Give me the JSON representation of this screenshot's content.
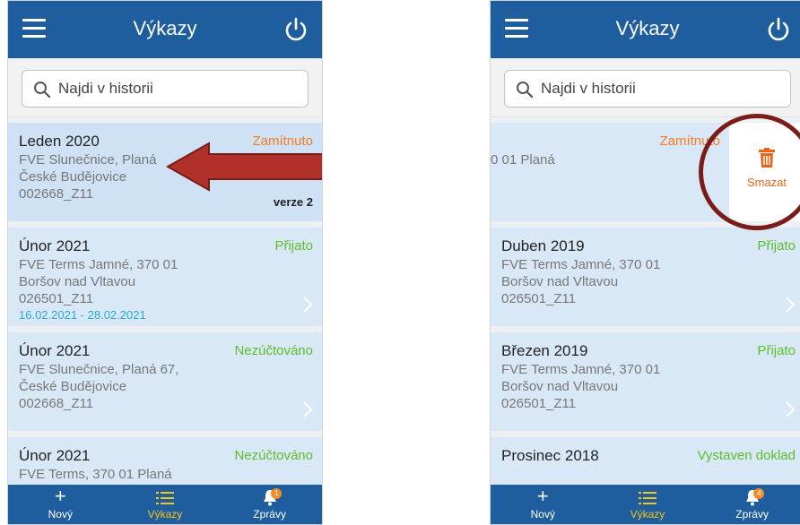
{
  "colors": {
    "appbar": "#1f5e9e",
    "status_rejected": "#f57c20",
    "status_accepted": "#5cbf2a",
    "active_tab": "#f5c518",
    "dates": "#2aa8d8",
    "annotation": "#b0312a"
  },
  "header": {
    "title": "Výkazy",
    "menu_icon": "hamburger-icon",
    "power_icon": "power-icon"
  },
  "search": {
    "placeholder": "Najdi v historii",
    "icon": "search-icon"
  },
  "left": {
    "items": [
      {
        "period": "Leden 2020",
        "line1": "FVE Slunečnice, Planá",
        "line2": "České Budějovice",
        "line3": "002668_Z11",
        "status": "Zamítnuto",
        "version": "verze 2"
      },
      {
        "period": "Únor 2021",
        "line1": "FVE Terms Jamné, 370 01",
        "line2": "Boršov nad Vltavou",
        "line3": "026501_Z11",
        "dates": "16.02.2021 - 28.02.2021",
        "status": "Přijato"
      },
      {
        "period": "Únor 2021",
        "line1": "FVE Slunečnice, Planá 67,",
        "line2": "České Budějovice",
        "line3": "002668_Z11",
        "status": "Nezúčtováno"
      },
      {
        "period": "Únor 2021",
        "line1": "FVE Terms, 370 01 Planá",
        "line2": "",
        "line3": "",
        "status": "Nezúčtováno"
      }
    ]
  },
  "right": {
    "swiped": {
      "line1": "0 01 Planá",
      "status": "Zamítnuto",
      "delete_label": "Smazat",
      "delete_icon": "trash-icon"
    },
    "items": [
      {
        "period": "Duben 2019",
        "line1": "FVE Terms Jamné, 370 01",
        "line2": "Boršov nad Vltavou",
        "line3": "026501_Z11",
        "status": "Přijato"
      },
      {
        "period": "Březen 2019",
        "line1": "FVE Terms Jamné, 370 01",
        "line2": "Boršov nad Vltavou",
        "line3": "026501_Z11",
        "status": "Přijato"
      },
      {
        "period": "Prosinec 2018",
        "line1": "",
        "line2": "",
        "line3": "",
        "status": "Vystaven doklad"
      }
    ]
  },
  "tabs": [
    {
      "label": "Nový",
      "icon": "plus-icon"
    },
    {
      "label": "Výkazy",
      "icon": "list-icon"
    },
    {
      "label": "Zprávy",
      "icon": "bell-icon",
      "badge": "1"
    }
  ],
  "tabs_right_badge": "4"
}
